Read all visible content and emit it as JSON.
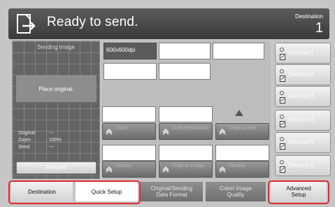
{
  "header": {
    "title": "Ready to send.",
    "destination_label": "Destination",
    "destination_count": "1"
  },
  "preview": {
    "title": "Sending Image",
    "place_text": "Place original.",
    "info": [
      {
        "key": "Original",
        "value": ": ---"
      },
      {
        "key": "Zoom",
        "value": ": 100%"
      },
      {
        "key": "Send",
        "value": ": ---"
      }
    ],
    "preview_button": "Preview"
  },
  "summary": {
    "resolution": "600x600dpi"
  },
  "function_buttons": [
    {
      "label": "Color"
    },
    {
      "label": "Scan Resolution"
    },
    {
      "label": "Original Size"
    },
    {
      "label": "Density"
    },
    {
      "label": "Original Image"
    },
    {
      "label": "Density"
    }
  ],
  "destinations": [
    {
      "label": "Shortcut 1"
    },
    {
      "label": "Shortcut 2"
    },
    {
      "label": "Shortcut 3"
    },
    {
      "label": "Shortcut 4"
    },
    {
      "label": "Shortcut 5"
    },
    {
      "label": "Shortcut 6"
    }
  ],
  "tabs": [
    {
      "label": "Destination"
    },
    {
      "label": "Quick Setup"
    },
    {
      "label": "Original/Sending Data Format"
    },
    {
      "label": "Color/ Image Quality"
    },
    {
      "label": "Advanced Setup"
    }
  ],
  "colors": {
    "header_bg": "#3f3f3f",
    "highlight": "#e0282e",
    "selected_tab": "#ffffff"
  }
}
